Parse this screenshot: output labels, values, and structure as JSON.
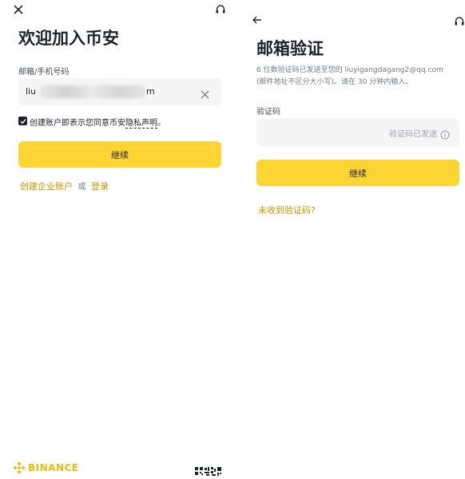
{
  "signup": {
    "title": "欢迎加入币安",
    "field_label": "邮箱/手机号码",
    "email_prefix": "liu",
    "email_suffix": "m",
    "agreement_prefix": "创建账户即表示您同意币安",
    "agreement_link": "隐私声明",
    "agreement_suffix": "。",
    "continue_label": "继续",
    "business_link": "创建企业账户",
    "or_text": "或",
    "login_link": "登录",
    "brand": "BINANCE",
    "accent_color": "#fcd535",
    "link_color": "#c99400",
    "brand_color": "#f0b90b"
  },
  "verify": {
    "title": "邮箱验证",
    "desc_line1": "6 位数验证码已发送至您的 liuyigangdagang2@qq.com",
    "desc_line2": "(邮件地址不区分大小写)。请在 30 分钟内输入。",
    "code_label": "验证码",
    "code_status": "验证码已发送",
    "continue_label": "继续",
    "resend_link": "未收到验证码?"
  }
}
